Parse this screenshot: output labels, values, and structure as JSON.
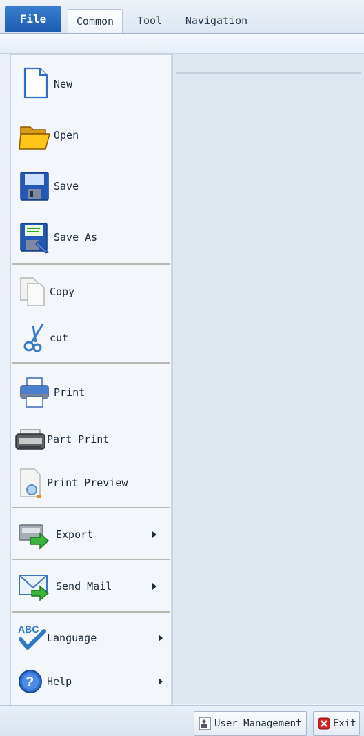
{
  "ribbon": {
    "file_label": "File",
    "tabs": [
      {
        "label": "Common"
      },
      {
        "label": "Tool"
      },
      {
        "label": "Navigation"
      }
    ]
  },
  "file_menu": {
    "items": [
      {
        "label": "New",
        "icon": "new-document-icon"
      },
      {
        "label": "Open",
        "icon": "folder-open-icon"
      },
      {
        "label": "Save",
        "icon": "floppy-save-icon"
      },
      {
        "label": "Save As",
        "icon": "save-as-icon"
      },
      {
        "label": "Copy",
        "icon": "copy-icon"
      },
      {
        "label": "cut",
        "icon": "scissors-icon"
      },
      {
        "label": "Print",
        "icon": "printer-icon"
      },
      {
        "label": "Part Print",
        "icon": "part-print-icon"
      },
      {
        "label": "Print Preview",
        "icon": "print-preview-icon"
      },
      {
        "label": "Export",
        "icon": "export-icon",
        "has_submenu": true
      },
      {
        "label": "Send Mail",
        "icon": "send-mail-icon",
        "has_submenu": true
      },
      {
        "label": "Language",
        "icon": "language-abc-icon",
        "has_submenu": true
      },
      {
        "label": "Help",
        "icon": "help-icon",
        "has_submenu": true
      }
    ]
  },
  "bottom_bar": {
    "user_management_label": "User Management",
    "exit_label": "Exit"
  },
  "colors": {
    "file_tab": "#1c5cb0",
    "menu_background": "#f3f7fb",
    "content_background": "#dee6f0"
  }
}
